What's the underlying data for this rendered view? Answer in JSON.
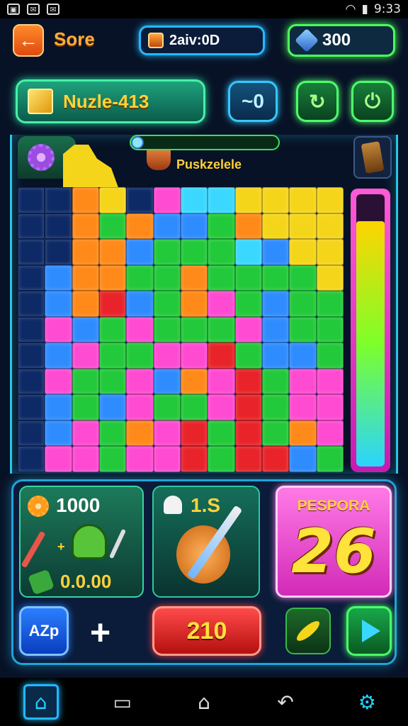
{
  "status_bar": {
    "time": "9:33",
    "left_icons": [
      "image-icon",
      "notification-icon",
      "notification-icon"
    ]
  },
  "header": {
    "back_icon": "arrow-left-icon",
    "title": "Sore",
    "coins": "2aiv:0D",
    "gems": "300"
  },
  "level": {
    "name": "Nuzle-413",
    "zero_button": "~0",
    "redo_icon": "redo-icon",
    "power_icon": "power-icon"
  },
  "board": {
    "progress_label": "Puskzelele",
    "progress": 0.05,
    "meter_fill": 0.9,
    "palette": {
      "yellow": "#f5d51a",
      "orange": "#ff8a1a",
      "red": "#e8242a",
      "green": "#22c93a",
      "blue": "#2f8cff",
      "cyan": "#3ad8ff",
      "pink": "#ff4ad2",
      "magenta": "#e62cd6",
      "dark": "#0e2a66"
    },
    "rows": [
      "XXOYXPCCYYYY",
      "XXOGOBBGOYYY",
      "XXOOBGGGCBYY",
      "XBOOGGOGGGGY",
      "XBORBGOPGBGG",
      "XPBGPGGGPBGG",
      "XBPGGPPRGBBG",
      "XPGGPBOPRGPP",
      "XBGBPGGPRGPP",
      "XBPGOPRGRGOP",
      "XPPGPPRGRRBG"
    ]
  },
  "stats": {
    "gold": "1000",
    "score": "0.0.00",
    "tool_count": "1.S",
    "bonus_label": "PESPORA",
    "bonus_value": "26"
  },
  "actions": {
    "azp_label": "AZp",
    "plus": "+",
    "main_value": "210",
    "play_icon": "play-icon"
  },
  "nav": [
    "home-icon",
    "recent-apps-icon",
    "home-outline-icon",
    "back-icon",
    "settings-icon"
  ]
}
